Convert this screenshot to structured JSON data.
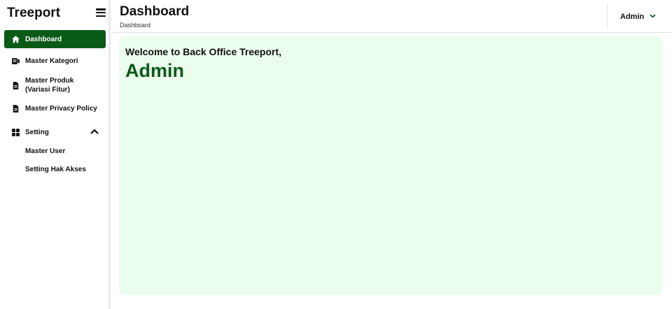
{
  "sidebar": {
    "brand": "Treeport",
    "items": [
      {
        "label": "Dashboard",
        "icon": "home-icon",
        "active": true
      },
      {
        "label": "Master Kategori",
        "icon": "category-icon"
      },
      {
        "label": "Master Produk (Variasi Fitur)",
        "icon": "document-icon"
      },
      {
        "label": "Master Privacy Policy",
        "icon": "document-icon"
      },
      {
        "label": "Setting",
        "icon": "grid-icon",
        "expanded": true
      }
    ],
    "sub_items": [
      {
        "label": "Master User"
      },
      {
        "label": "Setting Hak Akses"
      }
    ]
  },
  "header": {
    "title": "Dashboard",
    "breadcrumb": "Dashboard",
    "user": "Admin"
  },
  "main": {
    "welcome": "Welcome to Back Office Treeport,",
    "user_name": "Admin"
  },
  "colors": {
    "accent": "#0a5a17",
    "card_bg": "#ebfdec"
  }
}
